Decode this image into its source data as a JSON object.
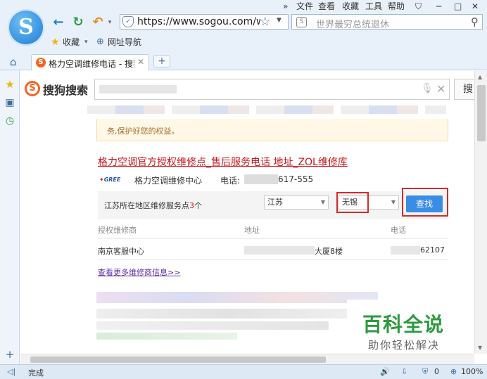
{
  "browser": {
    "menu": [
      "文件",
      "查看",
      "收藏",
      "工具",
      "帮助"
    ],
    "url": "https://www.sogou.com/we",
    "search_placeholder": "世界最穷总统退休",
    "bookmarks": [
      "收藏",
      "网址导航"
    ],
    "tab_title": "格力空调维修电话 - 搜狗",
    "status_left": "完成",
    "status_zoom": "100%",
    "status_count": "0"
  },
  "page": {
    "logo_text": "搜狗搜索",
    "search_button": "搜",
    "notice_text": "务,保护好您的权益。",
    "result": {
      "title": "格力空调官方授权维修点_售后服务电话 地址_ZOL维修库",
      "brand_logo": "GREE",
      "center_name": "格力空调维修中心",
      "phone_label": "电话:",
      "phone_suffix": "617-555",
      "filter_prefix": "江苏所在地区维修服务点",
      "filter_count": "3",
      "filter_suffix": "个",
      "province": "江苏",
      "city": "无锡",
      "find_button": "查找",
      "columns": [
        "授权维修商",
        "地址",
        "电话"
      ],
      "row": {
        "name": "南京客服中心",
        "address_suffix": "大厦8楼",
        "phone_suffix": "62107"
      },
      "more_link": "查看更多维修商信息>>"
    },
    "watermark": {
      "main": "百科全说",
      "sub": "助你轻松解决"
    }
  }
}
